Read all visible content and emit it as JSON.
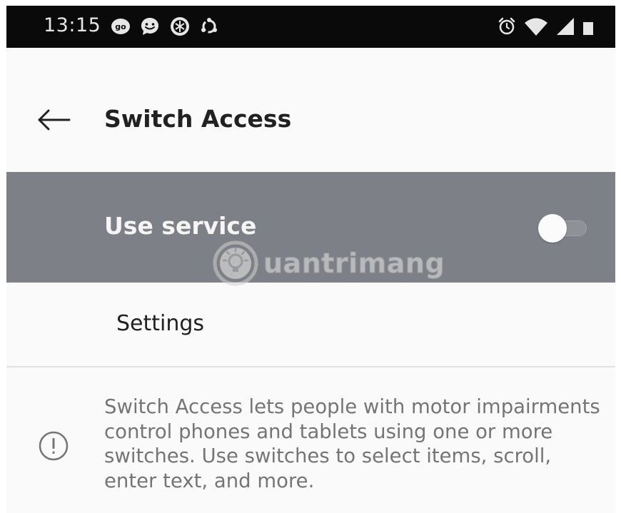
{
  "status_bar": {
    "time": "13:15",
    "left_icons": [
      "go-app-icon",
      "chat-bubble-icon",
      "shield-app-icon",
      "sync-app-icon"
    ],
    "right_icons": [
      "alarm-icon",
      "wifi-icon",
      "cellular-signal-icon",
      "battery-icon"
    ]
  },
  "toolbar": {
    "title": "Switch Access"
  },
  "use_service": {
    "label": "Use service",
    "enabled": false
  },
  "settings": {
    "label": "Settings"
  },
  "info": {
    "text": "Switch Access lets people with motor impairments control phones and tablets using one or more switches. Use switches to select items, scroll, enter text, and more."
  },
  "watermark": {
    "text": "uantrimang"
  },
  "colors": {
    "status_bar_bg": "#0a0a0a",
    "highlight_row_bg": "#7d8086",
    "page_bg": "#fafafa",
    "title_text": "#212121",
    "secondary_text": "#757575"
  }
}
